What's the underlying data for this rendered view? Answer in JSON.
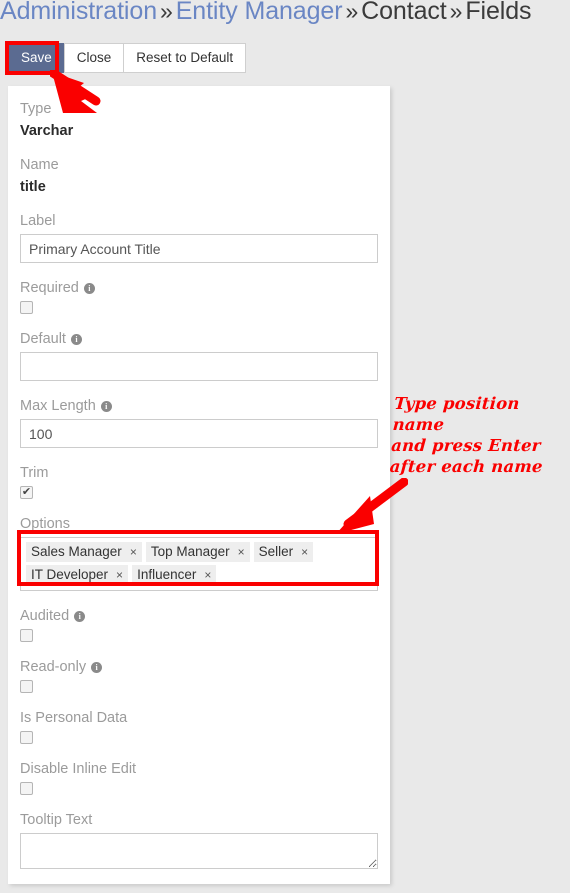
{
  "breadcrumb": {
    "items": [
      {
        "label": "Administration",
        "type": "link"
      },
      {
        "label": "Entity Manager",
        "type": "link"
      },
      {
        "label": "Contact",
        "type": "plain"
      },
      {
        "label": "Fields",
        "type": "plain"
      }
    ],
    "separator": "»"
  },
  "toolbar": {
    "save_label": "Save",
    "close_label": "Close",
    "reset_label": "Reset to Default"
  },
  "form": {
    "type": {
      "label": "Type",
      "value": "Varchar"
    },
    "name": {
      "label": "Name",
      "value": "title"
    },
    "field_label": {
      "label": "Label",
      "value": "Primary Account Title",
      "placeholder": ""
    },
    "required": {
      "label": "Required",
      "checked": false,
      "info": "i"
    },
    "default": {
      "label": "Default",
      "value": "",
      "placeholder": "",
      "info": "i"
    },
    "max_length": {
      "label": "Max Length",
      "value": "100",
      "placeholder": "",
      "info": "i"
    },
    "trim": {
      "label": "Trim",
      "checked": true
    },
    "options": {
      "label": "Options",
      "tags": [
        "Sales Manager",
        "Top Manager",
        "Seller",
        "IT Developer",
        "Influencer"
      ],
      "remove_glyph": "×"
    },
    "audited": {
      "label": "Audited",
      "checked": false,
      "info": "i"
    },
    "read_only": {
      "label": "Read-only",
      "checked": false,
      "info": "i"
    },
    "is_personal_data": {
      "label": "Is Personal Data",
      "checked": false
    },
    "disable_inline_edit": {
      "label": "Disable Inline Edit",
      "checked": false
    },
    "tooltip_text": {
      "label": "Tooltip Text",
      "value": "",
      "placeholder": ""
    }
  },
  "annotations": {
    "note": "Type position name\nand press Enter\nafter each name",
    "color": "#fa0000"
  },
  "checkmark_glyph": "✔"
}
